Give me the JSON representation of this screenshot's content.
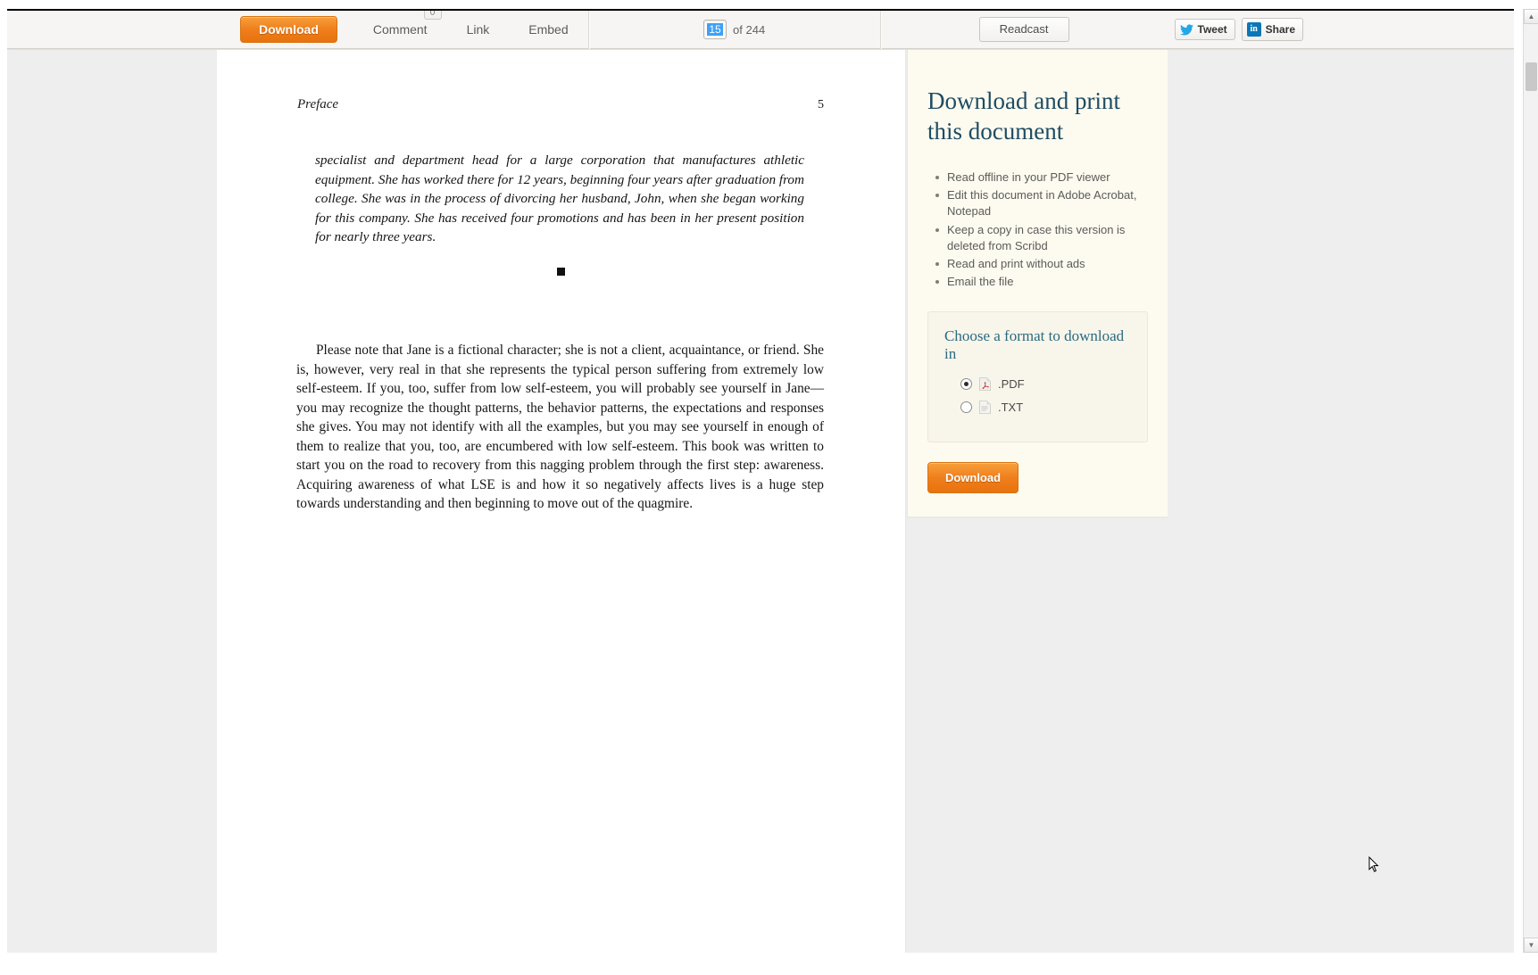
{
  "toolbar": {
    "download_label": "Download",
    "comment_label": "Comment",
    "comment_count": "0",
    "link_label": "Link",
    "embed_label": "Embed",
    "page_current": "15",
    "page_total": "of 244",
    "readcast_label": "Readcast",
    "tweet_label": "Tweet",
    "share_label": "Share",
    "linkedin_glyph": "in"
  },
  "document": {
    "header_title": "Preface",
    "header_page": "5",
    "italic_paragraph": "specialist and department head for a large corporation that manufactures athletic equipment. She has worked there for 12 years, beginning four years after graduation from college. She was in the process of divorcing her husband, John, when she began working for this company. She has received four promotions and has been in her present position for nearly three years.",
    "body_paragraph": "Please note that Jane is a fictional character; she is not a client, acquaintance, or friend. She is, however, very real in that she represents the typical person suffering from extremely low self-esteem. If you, too, suffer from low self-esteem, you will probably see yourself in Jane—you may recognize the thought patterns, the behavior patterns, the expectations and responses she gives. You may not identify with all the examples, but you may see yourself in enough of them to realize that you, too, are encumbered with low self-esteem. This book was written to start you on the road to recovery from this nagging problem through the first step: awareness. Acquiring awareness of what LSE is and how it so negatively affects lives is a huge step towards understanding and then beginning to move out of the quagmire."
  },
  "side_panel": {
    "title": "Download and print this document",
    "benefits": [
      "Read offline in your PDF viewer",
      "Edit this document in Adobe Acrobat, Notepad",
      "Keep a copy in case this version is deleted from Scribd",
      "Read and print without ads",
      "Email the file"
    ],
    "format_title": "Choose a format to download in",
    "formats": [
      {
        "label": ".PDF",
        "selected": true
      },
      {
        "label": ".TXT",
        "selected": false
      }
    ],
    "download_label": "Download"
  },
  "scrollbar": {
    "up_arrow": "▲",
    "down_arrow": "▼"
  },
  "colors": {
    "accent_orange": "#ef7e1c",
    "panel_cream": "#fdfbf0",
    "heading_navy": "#1f4c62",
    "format_teal": "#2b6b82",
    "page_highlight": "#3da2f7",
    "twitter_blue": "#22a7e8",
    "linkedin_blue": "#0b77b6"
  }
}
